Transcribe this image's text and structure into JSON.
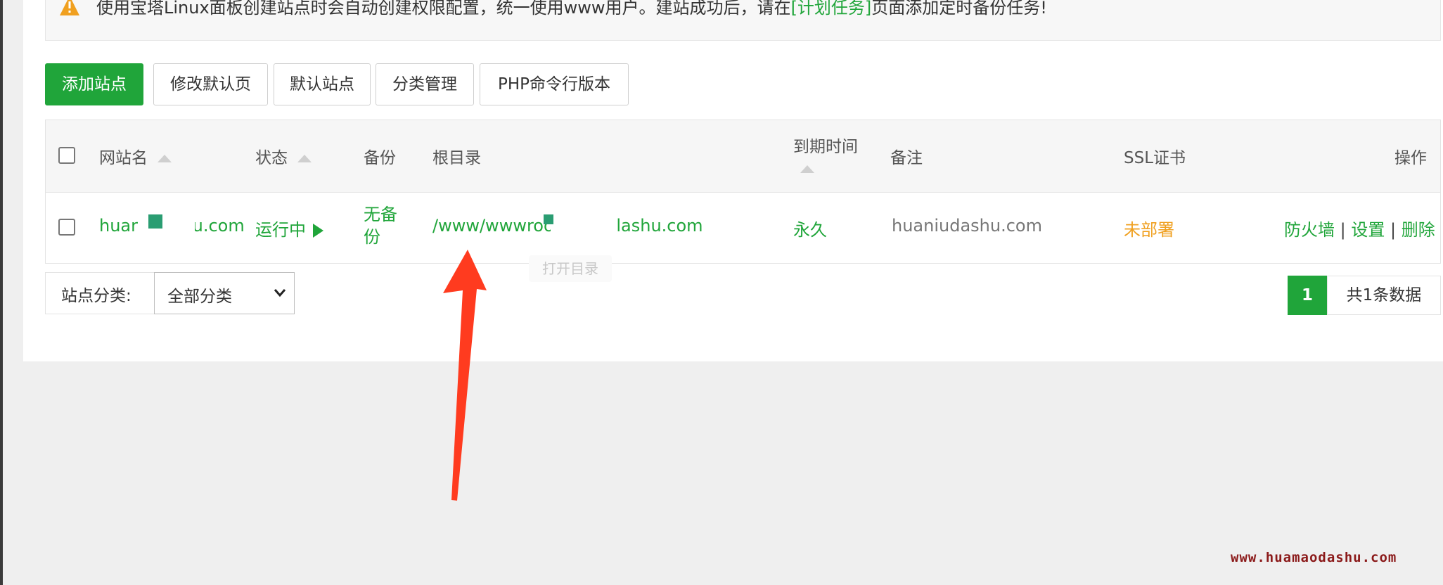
{
  "notice": {
    "text_before": "使用宝塔Linux面板创建站点时会自动创建权限配置，统一使用www用户。建站成功后，请在",
    "link_text": "[计划任务]",
    "text_after": "页面添加定时备份任务!"
  },
  "toolbar": {
    "add_site": "添加站点",
    "edit_default_page": "修改默认页",
    "default_site": "默认站点",
    "category_manage": "分类管理",
    "php_cli_version": "PHP命令行版本"
  },
  "table": {
    "headers": {
      "site_name": "网站名",
      "status": "状态",
      "backup": "备份",
      "root_dir": "根目录",
      "expire": "到期时间",
      "remark": "备注",
      "ssl": "SSL证书",
      "actions": "操作"
    },
    "rows": [
      {
        "site_name_a": "huar",
        "site_name_b": ".u.com",
        "status": "运行中",
        "backup_line1": "无备",
        "backup_line2": "份",
        "root_dir_a": "/www/wwwroot/h",
        "root_dir_b": "lashu.com",
        "expire": "永久",
        "remark": "huaniudashu.com",
        "ssl": "未部署",
        "action_firewall": "防火墙",
        "action_settings": "设置",
        "action_delete": "删除"
      }
    ]
  },
  "tooltip": "打开目录",
  "category_filter": {
    "label": "站点分类:",
    "selected": "全部分类"
  },
  "pagination": {
    "current_page": "1",
    "total_text": "共1条数据"
  },
  "watermark": "www.huamaodashu.com",
  "colors": {
    "accent": "#20a53a",
    "warning": "#f0a020",
    "annotation_arrow": "#ff3b1f"
  }
}
